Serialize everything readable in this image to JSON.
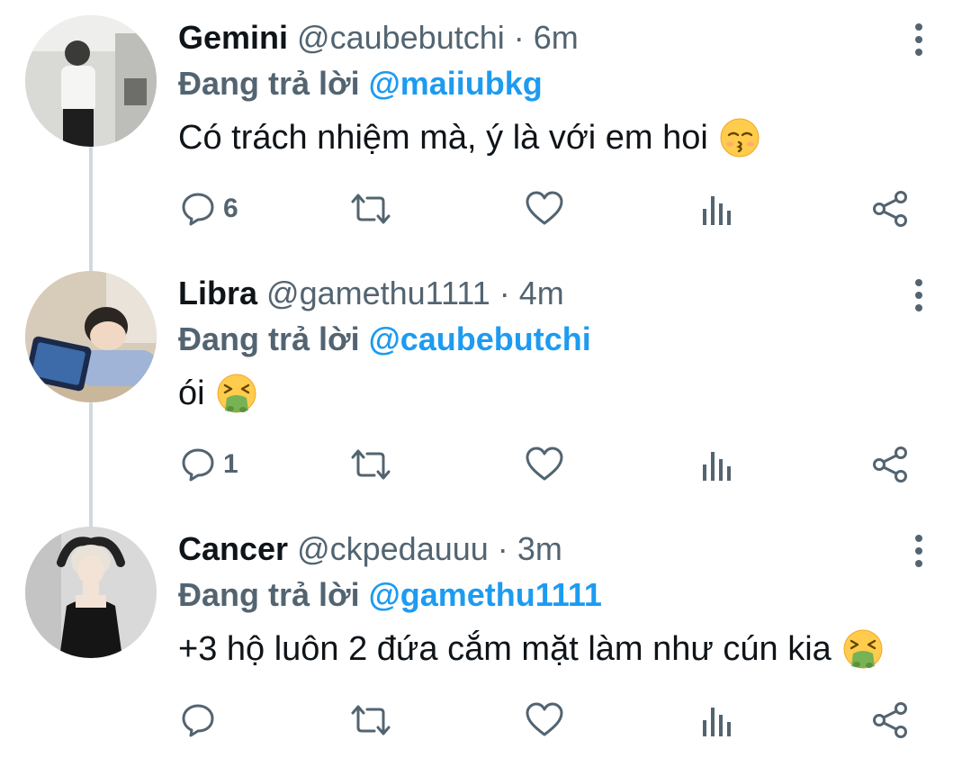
{
  "thread": {
    "tweets": [
      {
        "name": "Gemini",
        "handle": "@caubebutchi",
        "separator": "·",
        "time": "6m",
        "replying_prefix": "Đang trả lời",
        "replying_to": "@maiiubkg",
        "text": "Có trách nhiệm mà, ý là với em hoi",
        "emoji": "kissing-face-emoji",
        "reply_count": "6",
        "avatar": "avatar-photo-man-standing"
      },
      {
        "name": "Libra",
        "handle": "@gamethu1111",
        "separator": "·",
        "time": "4m",
        "replying_prefix": "Đang trả lời",
        "replying_to": "@caubebutchi",
        "text": "ói",
        "emoji": "vomiting-face-emoji",
        "reply_count": "1",
        "avatar": "avatar-photo-boy-with-tablet"
      },
      {
        "name": "Cancer",
        "handle": "@ckpedauuu",
        "separator": "·",
        "time": "3m",
        "replying_prefix": "Đang trả lời",
        "replying_to": "@gamethu1111",
        "text": "+3 hộ luôn 2 đứa cắm mặt làm như cún kia",
        "emoji": "vomiting-face-emoji",
        "reply_count": "",
        "avatar": "avatar-photo-woman-black-dress"
      }
    ]
  },
  "icons": {
    "reply": "reply-icon",
    "retweet": "retweet-icon",
    "like": "like-icon",
    "views": "views-icon",
    "share": "share-icon",
    "more": "more-options-icon"
  },
  "colors": {
    "accent": "#1d9bf0",
    "secondary_text": "#536471",
    "primary_text": "#0f1419",
    "thread_line": "#cfd9de"
  }
}
